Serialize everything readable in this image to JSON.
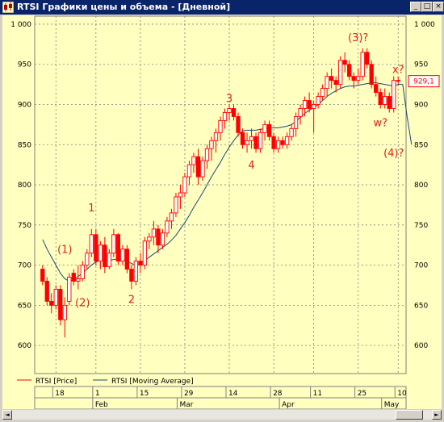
{
  "window": {
    "title": "RTSI Графики цены и объема - [Дневной]",
    "minimize_glyph": "_",
    "restore_glyph": "□",
    "close_glyph": "×",
    "title_icon": "candlestick-chart-icon",
    "scroll_left_glyph": "◄",
    "scroll_right_glyph": "►"
  },
  "chart_data": {
    "type": "candlestick",
    "title": "",
    "ylim": [
      565,
      1010
    ],
    "y_ticks": [
      600,
      650,
      700,
      750,
      800,
      850,
      900,
      950,
      1000
    ],
    "y_tick_labels": [
      "600",
      "650",
      "700",
      "750",
      "800",
      "850",
      "900",
      "950",
      "1 000"
    ],
    "grid": true,
    "last_value_label": "929,1",
    "colors": {
      "background": "#ffffc0",
      "candle": "#ff0000",
      "moving_average": "#184878",
      "annotation": "#e02020",
      "grid": "#808080"
    },
    "legend": [
      {
        "label": "RTSI [Price]",
        "color": "#ff0000"
      },
      {
        "label": "RTSI [Moving Average]",
        "color": "#184878"
      }
    ],
    "x_day_labels": [
      {
        "label": "18",
        "index": 3
      },
      {
        "label": "1",
        "index": 12
      },
      {
        "label": "15",
        "index": 22
      },
      {
        "label": "29",
        "index": 32
      },
      {
        "label": "14",
        "index": 42
      },
      {
        "label": "28",
        "index": 52
      },
      {
        "label": "11",
        "index": 61
      },
      {
        "label": "25",
        "index": 71
      },
      {
        "label": "10",
        "index": 80
      }
    ],
    "x_month_labels": [
      {
        "label": "Feb",
        "index": 12
      },
      {
        "label": "Mar",
        "index": 31
      },
      {
        "label": "Apr",
        "index": 54
      },
      {
        "label": "May",
        "index": 77
      }
    ],
    "series": [
      {
        "name": "RTSI [Price]",
        "ohlc": [
          [
            695,
            700,
            675,
            680
          ],
          [
            680,
            685,
            650,
            655
          ],
          [
            655,
            665,
            640,
            650
          ],
          [
            650,
            675,
            645,
            670
          ],
          [
            670,
            675,
            625,
            632
          ],
          [
            632,
            660,
            610,
            650
          ],
          [
            655,
            690,
            650,
            685
          ],
          [
            690,
            695,
            675,
            680
          ],
          [
            680,
            700,
            670,
            683
          ],
          [
            683,
            705,
            680,
            700
          ],
          [
            700,
            720,
            695,
            715
          ],
          [
            715,
            745,
            710,
            738
          ],
          [
            738,
            745,
            700,
            705
          ],
          [
            705,
            730,
            695,
            725
          ],
          [
            725,
            735,
            690,
            698
          ],
          [
            698,
            720,
            695,
            715
          ],
          [
            715,
            745,
            710,
            738
          ],
          [
            738,
            740,
            700,
            705
          ],
          [
            705,
            725,
            700,
            720
          ],
          [
            720,
            725,
            690,
            695
          ],
          [
            695,
            700,
            670,
            680
          ],
          [
            680,
            710,
            675,
            705
          ],
          [
            705,
            715,
            690,
            700
          ],
          [
            700,
            735,
            695,
            730
          ],
          [
            730,
            740,
            720,
            735
          ],
          [
            735,
            755,
            725,
            745
          ],
          [
            745,
            750,
            715,
            725
          ],
          [
            725,
            745,
            720,
            740
          ],
          [
            740,
            760,
            735,
            755
          ],
          [
            755,
            770,
            745,
            765
          ],
          [
            765,
            790,
            760,
            785
          ],
          [
            785,
            800,
            770,
            790
          ],
          [
            790,
            815,
            785,
            810
          ],
          [
            810,
            830,
            800,
            825
          ],
          [
            825,
            840,
            815,
            835
          ],
          [
            835,
            845,
            800,
            810
          ],
          [
            810,
            835,
            805,
            830
          ],
          [
            830,
            850,
            820,
            845
          ],
          [
            845,
            860,
            830,
            855
          ],
          [
            855,
            870,
            840,
            865
          ],
          [
            865,
            885,
            855,
            880
          ],
          [
            880,
            895,
            870,
            890
          ],
          [
            890,
            900,
            880,
            895
          ],
          [
            895,
            900,
            880,
            885
          ],
          [
            885,
            890,
            860,
            865
          ],
          [
            865,
            870,
            845,
            850
          ],
          [
            850,
            865,
            840,
            855
          ],
          [
            855,
            870,
            845,
            860
          ],
          [
            860,
            865,
            840,
            845
          ],
          [
            845,
            870,
            840,
            865
          ],
          [
            865,
            880,
            855,
            875
          ],
          [
            875,
            880,
            855,
            860
          ],
          [
            860,
            865,
            840,
            845
          ],
          [
            845,
            860,
            840,
            855
          ],
          [
            855,
            860,
            845,
            850
          ],
          [
            850,
            865,
            845,
            860
          ],
          [
            860,
            875,
            855,
            870
          ],
          [
            870,
            890,
            860,
            885
          ],
          [
            885,
            900,
            875,
            895
          ],
          [
            895,
            910,
            885,
            905
          ],
          [
            905,
            915,
            890,
            895
          ],
          [
            895,
            905,
            865,
            900
          ],
          [
            900,
            915,
            895,
            910
          ],
          [
            910,
            925,
            905,
            920
          ],
          [
            920,
            940,
            910,
            935
          ],
          [
            935,
            945,
            920,
            930
          ],
          [
            930,
            935,
            915,
            925
          ],
          [
            925,
            960,
            920,
            955
          ],
          [
            955,
            965,
            940,
            950
          ],
          [
            950,
            955,
            930,
            935
          ],
          [
            935,
            940,
            920,
            930
          ],
          [
            930,
            945,
            925,
            935
          ],
          [
            935,
            970,
            930,
            965
          ],
          [
            965,
            970,
            945,
            950
          ],
          [
            950,
            955,
            920,
            925
          ],
          [
            925,
            935,
            910,
            915
          ],
          [
            915,
            920,
            895,
            900
          ],
          [
            900,
            920,
            895,
            910
          ],
          [
            910,
            915,
            890,
            895
          ],
          [
            895,
            935,
            890,
            930
          ],
          [
            930,
            935,
            925,
            929
          ]
        ]
      },
      {
        "name": "RTSI [Moving Average]",
        "values": [
          732,
          720,
          710,
          700,
          690,
          683,
          680,
          682,
          686,
          690,
          695,
          700,
          704,
          706,
          707,
          706,
          707,
          708,
          707,
          705,
          702,
          700,
          702,
          706,
          710,
          714,
          718,
          722,
          726,
          731,
          737,
          745,
          753,
          762,
          772,
          781,
          790,
          800,
          810,
          819,
          828,
          838,
          847,
          855,
          862,
          867,
          868,
          868,
          868,
          869,
          870,
          871,
          871,
          871,
          872,
          873,
          875,
          879,
          884,
          889,
          893,
          896,
          900,
          905,
          910,
          914,
          917,
          920,
          922,
          923,
          923,
          924,
          925,
          926,
          927,
          927,
          926,
          925,
          924,
          923,
          925,
          925,
          885,
          850
        ]
      }
    ],
    "annotations": [
      {
        "text": "(1)",
        "index": 5,
        "value": 715
      },
      {
        "text": "1",
        "index": 11,
        "value": 767
      },
      {
        "text": "(2)",
        "index": 9,
        "value": 649
      },
      {
        "text": "2",
        "index": 20,
        "value": 653
      },
      {
        "text": "3",
        "index": 42,
        "value": 903
      },
      {
        "text": "4",
        "index": 47,
        "value": 820
      },
      {
        "text": "(3)?",
        "index": 71,
        "value": 979
      },
      {
        "text": "x?",
        "index": 80,
        "value": 939
      },
      {
        "text": "w?",
        "index": 76,
        "value": 873
      },
      {
        "text": "(4)?",
        "index": 79,
        "value": 835
      }
    ]
  }
}
